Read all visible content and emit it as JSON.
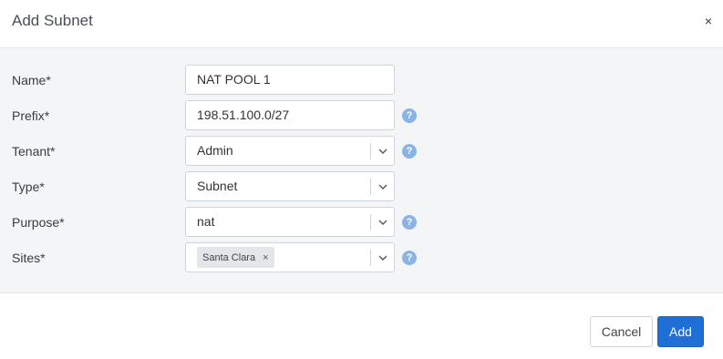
{
  "dialog": {
    "title": "Add Subnet",
    "close_glyph": "×"
  },
  "form": {
    "name": {
      "label": "Name*",
      "value": "NAT POOL 1"
    },
    "prefix": {
      "label": "Prefix*",
      "value": "198.51.100.0/27",
      "help_glyph": "?"
    },
    "tenant": {
      "label": "Tenant*",
      "value": "Admin",
      "help_glyph": "?"
    },
    "type": {
      "label": "Type*",
      "value": "Subnet"
    },
    "purpose": {
      "label": "Purpose*",
      "value": "nat",
      "help_glyph": "?"
    },
    "sites": {
      "label": "Sites*",
      "tags": [
        {
          "label": "Santa Clara",
          "remove_glyph": "×"
        }
      ],
      "help_glyph": "?"
    }
  },
  "footer": {
    "cancel_label": "Cancel",
    "add_label": "Add"
  },
  "colors": {
    "primary": "#1f6fd6",
    "help_icon": "#8ab4e8",
    "body_background": "#f4f5f7"
  },
  "icons": [
    "close-icon",
    "chevron-down-icon",
    "help-icon",
    "tag-remove-icon"
  ]
}
